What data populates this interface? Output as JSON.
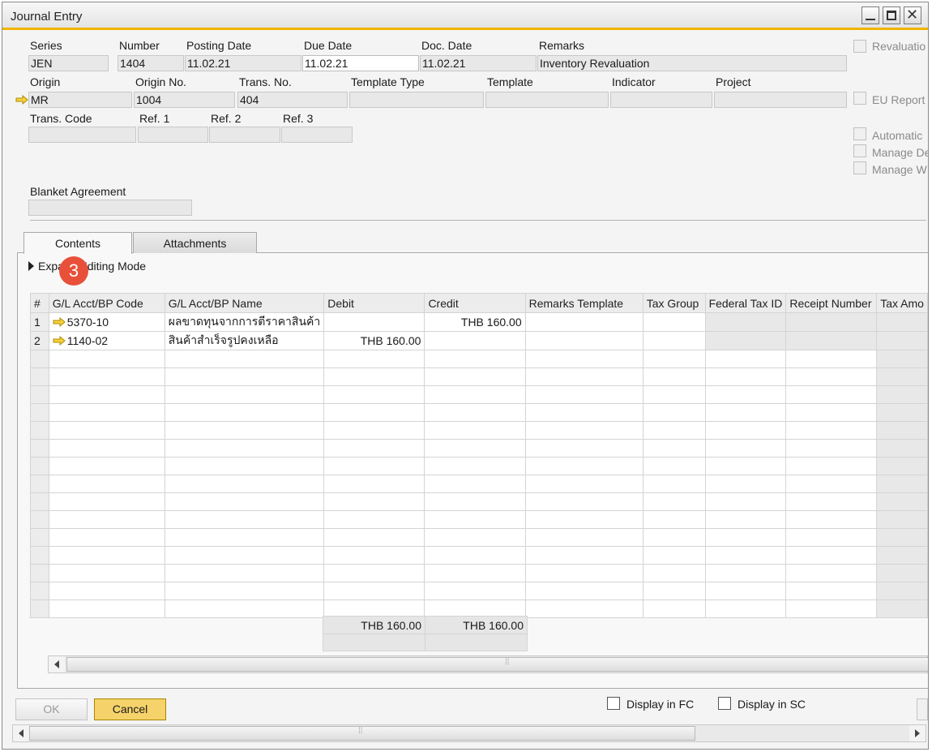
{
  "window": {
    "title": "Journal Entry"
  },
  "header": {
    "row1": {
      "series": {
        "label": "Series",
        "value": "JEN"
      },
      "number": {
        "label": "Number",
        "value": "1404"
      },
      "posting_date": {
        "label": "Posting Date",
        "value": "11.02.21"
      },
      "due_date": {
        "label": "Due Date",
        "value": "11.02.21"
      },
      "doc_date": {
        "label": "Doc. Date",
        "value": "11.02.21"
      },
      "remarks": {
        "label": "Remarks",
        "value": "Inventory Revaluation"
      }
    },
    "row2": {
      "origin": {
        "label": "Origin",
        "value": "MR"
      },
      "origin_no": {
        "label": "Origin No.",
        "value": "1004"
      },
      "trans_no": {
        "label": "Trans. No.",
        "value": "404"
      },
      "template_type": {
        "label": "Template Type",
        "value": ""
      },
      "template": {
        "label": "Template",
        "value": ""
      },
      "indicator": {
        "label": "Indicator",
        "value": ""
      },
      "project": {
        "label": "Project",
        "value": ""
      }
    },
    "row3": {
      "trans_code": {
        "label": "Trans. Code",
        "value": ""
      },
      "ref1": {
        "label": "Ref. 1",
        "value": ""
      },
      "ref2": {
        "label": "Ref. 2",
        "value": ""
      },
      "ref3": {
        "label": "Ref. 3",
        "value": ""
      }
    },
    "blanket_agreement": {
      "label": "Blanket Agreement",
      "value": ""
    }
  },
  "right_checks": {
    "revaluation": "Revaluatio",
    "eu_report": "EU Report",
    "automatic": "Automatic",
    "manage_de": "Manage De",
    "manage_w": "Manage W"
  },
  "tabs": {
    "contents": "Contents",
    "attachments": "Attachments"
  },
  "expand": {
    "label": "Expand Editing Mode"
  },
  "badge": {
    "value": "3"
  },
  "grid": {
    "columns": [
      "#",
      "G/L Acct/BP Code",
      "G/L Acct/BP Name",
      "Debit",
      "Credit",
      "Remarks Template",
      "Tax Group",
      "Federal Tax ID",
      "Receipt Number",
      "Tax Amo"
    ],
    "rows": [
      {
        "num": "1",
        "code": "5370-10",
        "name": "ผลขาดทุนจากการตีราคาสินค้า",
        "debit": "",
        "credit": "THB 160.00"
      },
      {
        "num": "2",
        "code": "1140-02",
        "name": "สินค้าสำเร็จรูปคงเหลือ",
        "debit": "THB 160.00",
        "credit": ""
      }
    ],
    "totals": {
      "debit": "THB 160.00",
      "credit": "THB 160.00"
    }
  },
  "footer": {
    "ok": "OK",
    "cancel": "Cancel",
    "display_fc": "Display in FC",
    "display_sc": "Display in SC"
  },
  "colors": {
    "accent": "#f0b400",
    "cancel_button": "#f5d36a",
    "badge": "#e8503a"
  }
}
